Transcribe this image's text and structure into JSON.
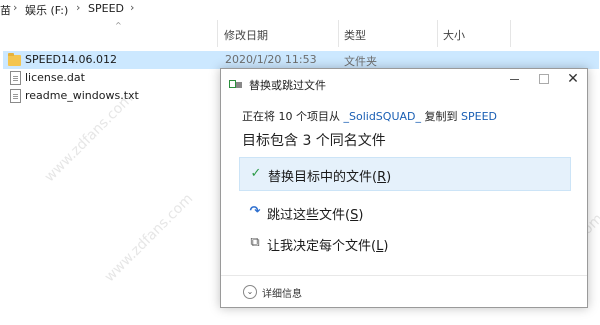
{
  "breadcrumb": {
    "part0": "苗",
    "part1": "娱乐 (F:)",
    "part2": "SPEED",
    "separator": "›"
  },
  "columns": {
    "name_sort": "^",
    "date": "修改日期",
    "type": "类型",
    "size": "大小"
  },
  "files": [
    {
      "name": "SPEED14.06.012",
      "date": "2020/1/20 11:53",
      "type": "文件夹",
      "icon": "folder-icon"
    },
    {
      "name": "license.dat",
      "icon": "document-icon"
    },
    {
      "name": "readme_windows.txt",
      "icon": "text-file-icon"
    }
  ],
  "dialog": {
    "title": "替换或跳过文件",
    "min_label": "",
    "close_label": "✕",
    "line1_prefix": "正在将 10 个项目从 ",
    "line1_source": "_SolidSQUAD_",
    "line1_middle": " 复制到 ",
    "line1_target": "SPEED",
    "line2": "目标包含 3 个同名文件",
    "options": [
      {
        "text": "替换目标中的文件(",
        "key": "R",
        "end": ")",
        "icon": "checkmark-icon",
        "glyph": "✓"
      },
      {
        "text": "跳过这些文件(",
        "key": "S",
        "end": ")",
        "icon": "skip-icon",
        "glyph": "↷"
      },
      {
        "text": "让我决定每个文件(",
        "key": "L",
        "end": ")",
        "icon": "decide-icon",
        "glyph": "⧉"
      }
    ],
    "more_details": "详细信息",
    "more_glyph": "⌄"
  },
  "watermark": "www.zdfans.com",
  "colors": {
    "selection": "#cce8ff",
    "highlight": "#e5f1fb",
    "link": "#1a5fb4",
    "check": "#2b9a47"
  }
}
